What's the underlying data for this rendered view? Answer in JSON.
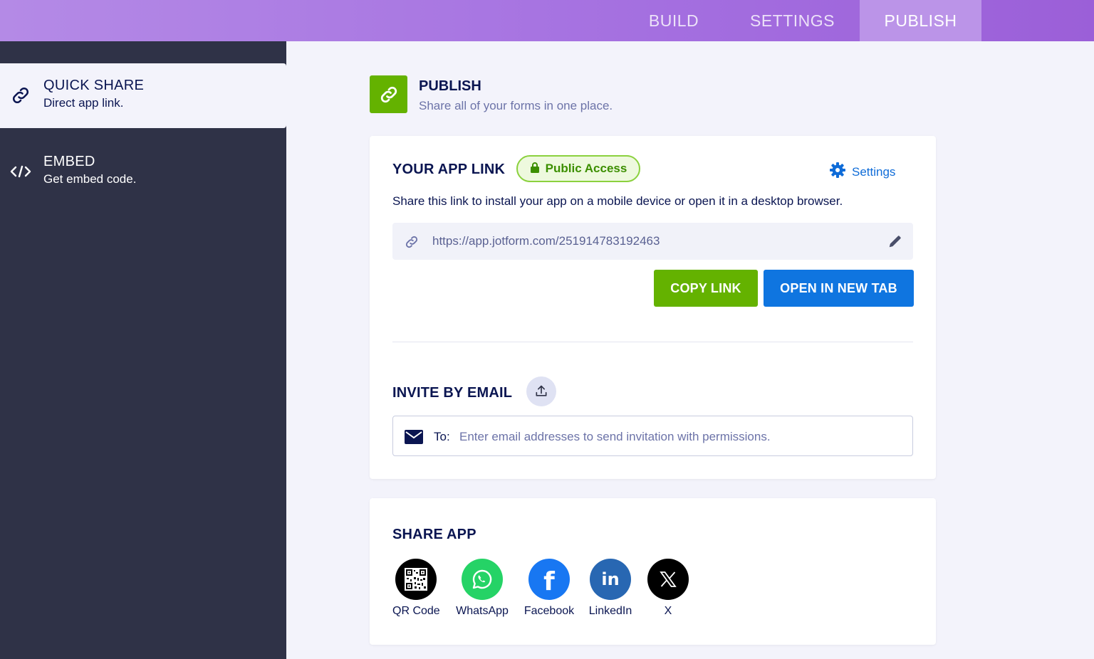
{
  "topbar": {
    "tabs": [
      {
        "label": "BUILD"
      },
      {
        "label": "SETTINGS"
      },
      {
        "label": "PUBLISH",
        "active": true
      }
    ]
  },
  "sidebar": {
    "items": [
      {
        "title": "QUICK SHARE",
        "subtitle": "Direct app link.",
        "icon": "link-icon",
        "active": true
      },
      {
        "title": "EMBED",
        "subtitle": "Get embed code.",
        "icon": "code-icon"
      }
    ]
  },
  "header": {
    "title": "PUBLISH",
    "subtitle": "Share all of your forms in one place."
  },
  "app_link": {
    "title": "YOUR APP LINK",
    "badge": "Public Access",
    "settings_label": "Settings",
    "description": "Share this link to install your app on a mobile device or open it in a desktop browser.",
    "url": "https://app.jotform.com/251914783192463",
    "copy_label": "COPY LINK",
    "open_label": "OPEN IN NEW TAB"
  },
  "invite": {
    "title": "INVITE BY EMAIL",
    "to_label": "To:",
    "placeholder": "Enter email addresses to send invitation with permissions."
  },
  "share": {
    "title": "SHARE APP",
    "items": [
      {
        "label": "QR Code",
        "icon": "qr-code-icon",
        "color": "#000000"
      },
      {
        "label": "WhatsApp",
        "icon": "whatsapp-icon",
        "color": "#25d366"
      },
      {
        "label": "Facebook",
        "icon": "facebook-icon",
        "color": "#1877f2"
      },
      {
        "label": "LinkedIn",
        "icon": "linkedin-icon",
        "color": "#2867b2"
      },
      {
        "label": "X",
        "icon": "x-icon",
        "color": "#000000"
      }
    ]
  },
  "colors": {
    "accent_green": "#64b200",
    "accent_blue": "#0f6cd8",
    "sidebar_bg": "#2f3247",
    "topbar": "#a46fe0"
  }
}
